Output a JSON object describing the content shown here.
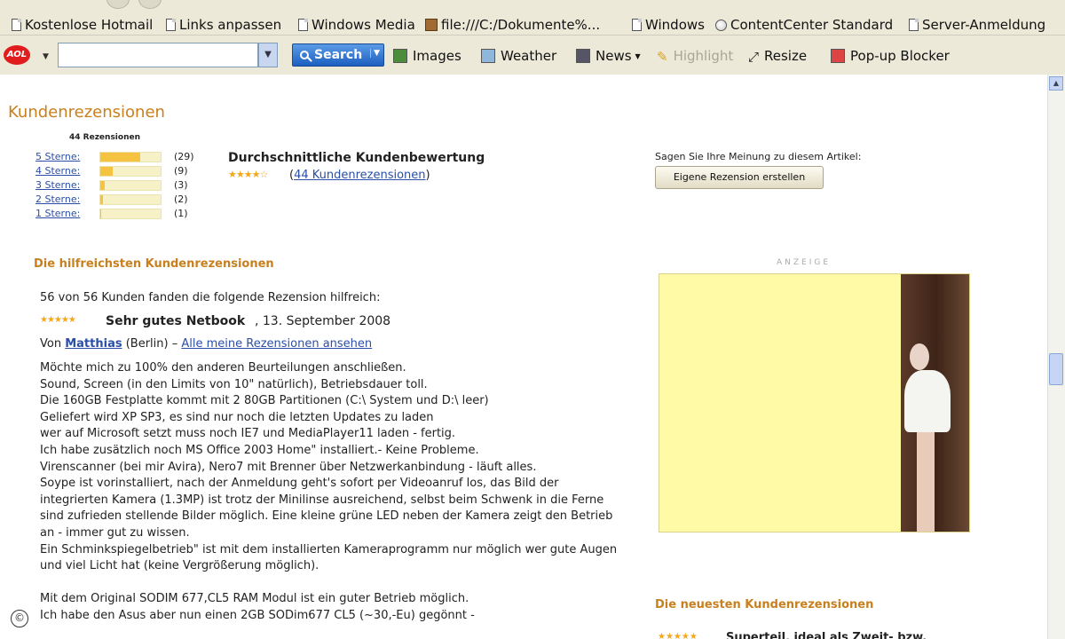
{
  "browser": {
    "links_bar": [
      {
        "label": "Kostenlose Hotmail",
        "icon": "page-icon"
      },
      {
        "label": "Links anpassen",
        "icon": "page-icon"
      },
      {
        "label": "Windows Media",
        "icon": "page-icon"
      },
      {
        "label": "file:///C:/Dokumente%...",
        "icon": "app-icon"
      },
      {
        "label": "Windows",
        "icon": "page-icon"
      },
      {
        "label": "ContentCenter Standard",
        "icon": "globe-icon"
      },
      {
        "label": "Server-Anmeldung",
        "icon": "page-icon"
      }
    ],
    "toolbar": {
      "logo_text": "AOL",
      "search_value": "",
      "search_button_label": "Search",
      "images_label": "Images",
      "weather_label": "Weather",
      "news_label": "News",
      "highlight_label": "Highlight",
      "resize_label": "Resize",
      "popup_label": "Pop-up Blocker"
    }
  },
  "page": {
    "title": "Kundenrezensionen",
    "rating_summary": {
      "total_label": "44 Rezensionen",
      "rows": [
        {
          "label": "5 Sterne:",
          "count": "(29)",
          "fraction": 0.66
        },
        {
          "label": "4 Sterne:",
          "count": "(9)",
          "fraction": 0.2
        },
        {
          "label": "3 Sterne:",
          "count": "(3)",
          "fraction": 0.07
        },
        {
          "label": "2 Sterne:",
          "count": "(2)",
          "fraction": 0.05
        },
        {
          "label": "1 Sterne:",
          "count": "(1)",
          "fraction": 0.02
        }
      ]
    },
    "average": {
      "label": "Durchschnittliche Kundenbewertung",
      "stars": "★★★★☆",
      "link_open": "(",
      "link_text": "44 Kundenrezensionen",
      "link_close": ")"
    },
    "opinion": {
      "label": "Sagen Sie Ihre Meinung zu diesem Artikel:",
      "button_label": "Eigene Rezension erstellen"
    },
    "helpful_heading": "Die hilfreichsten Kundenrezensionen",
    "review": {
      "helpful_text": "56 von 56 Kunden fanden die folgende Rezension hilfreich:",
      "stars": "★★★★★",
      "title": "Sehr gutes Netbook",
      "date": ", 13. September 2008",
      "by_label": "Von",
      "author": "Matthias",
      "location": "(Berlin) –",
      "all_reviews_link": "Alle meine Rezensionen ansehen",
      "body": [
        "Möchte mich zu 100% den anderen Beurteilungen anschließen.\nSound, Screen (in den Limits von 10\" natürlich), Betriebsdauer toll.\nDie 160GB Festplatte kommt mit 2 80GB Partitionen (C:\\ System und D:\\ leer)\nGeliefert wird XP SP3, es sind nur noch die letzten Updates zu laden\nwer auf Microsoft setzt muss noch IE7 und MediaPlayer11 laden - fertig.\nIch habe zusätzlich noch MS Office 2003 Home\" installiert.- Keine Probleme.\nVirenscanner (bei mir Avira), Nero7 mit Brenner über Netzwerkanbindung - läuft alles.\nSoype ist vorinstalliert, nach der Anmeldung geht's sofort per Videoanruf los, das Bild der integrierten Kamera (1.3MP) ist trotz der Minilinse ausreichend, selbst beim Schwenk in die Ferne sind zufrieden stellende Bilder möglich. Eine kleine grüne LED neben der Kamera zeigt den Betrieb an - immer gut zu wissen.\nEin Schminkspiegelbetrieb\" ist mit dem installierten Kameraprogramm nur möglich wer gute Augen und viel Licht hat (keine Vergrößerung möglich).",
        "Mit dem Original SODIM 677,CL5 RAM Modul ist ein guter Betrieb möglich.\nIch habe den Asus aber nun einen 2GB SODim677 CL5 (~30,-Eu) gegönnt -"
      ]
    },
    "ad": {
      "label": "ANZEIGE"
    },
    "newest_heading": "Die neuesten Kundenrezensionen",
    "newest_stars": "★★★★★",
    "newest_teaser": "Superteil, ideal als Zweit- bzw."
  }
}
